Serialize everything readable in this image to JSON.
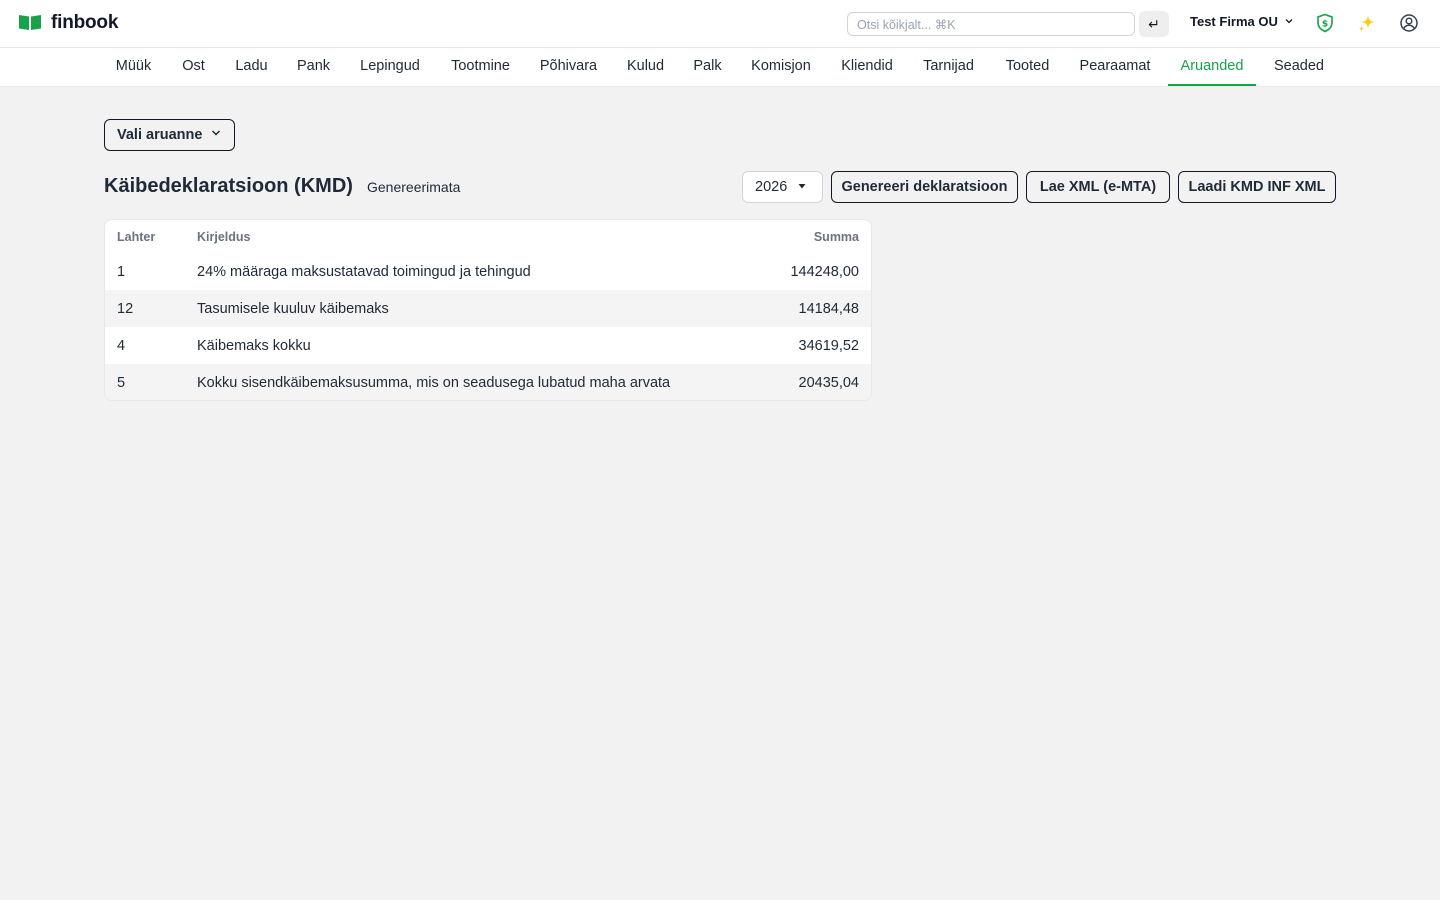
{
  "app": {
    "name": "finbook"
  },
  "search": {
    "placeholder": "Otsi kõikjalt...  ⌘K"
  },
  "header": {
    "enter_icon": "↵",
    "company": "Test Firma OU"
  },
  "nav": {
    "tabs": [
      {
        "label": "Müük"
      },
      {
        "label": "Ost"
      },
      {
        "label": "Ladu"
      },
      {
        "label": "Pank"
      },
      {
        "label": "Lepingud"
      },
      {
        "label": "Tootmine"
      },
      {
        "label": "Põhivara"
      },
      {
        "label": "Kulud"
      },
      {
        "label": "Palk"
      },
      {
        "label": "Komisjon"
      },
      {
        "label": "Kliendid"
      },
      {
        "label": "Tarnijad"
      },
      {
        "label": "Tooted"
      },
      {
        "label": "Pearaamat"
      },
      {
        "label": "Aruanded"
      },
      {
        "label": "Seaded"
      }
    ],
    "active": "Aruanded"
  },
  "report_select": {
    "label": "Vali aruanne"
  },
  "page": {
    "title": "Käibedeklaratsioon (KMD)",
    "status": "Genereerimata"
  },
  "year_select": {
    "value": "2026"
  },
  "actions": {
    "generate": "Genereeri deklaratsioon",
    "upload_xml": "Lae XML (e-MTA)",
    "download_inf": "Laadi KMD INF XML"
  },
  "table": {
    "headers": {
      "box": "Lahter",
      "description": "Kirjeldus",
      "sum": "Summa"
    },
    "rows": [
      {
        "box": "1",
        "description": "24% määraga maksustatavad toimingud ja tehingud",
        "sum": "144248,00"
      },
      {
        "box": "12",
        "description": "Tasumisele kuuluv käibemaks",
        "sum": "14184,48"
      },
      {
        "box": "4",
        "description": "Käibemaks kokku",
        "sum": "34619,52"
      },
      {
        "box": "5",
        "description": "Kokku sisendkäibemaksusumma, mis on seadusega lubatud maha arvata",
        "sum": "20435,04"
      }
    ]
  },
  "colors": {
    "accent": "#16a34a",
    "background": "#f2f2f2",
    "sparkle": "#facc15"
  },
  "icons": {
    "logo": "book-icon",
    "shield": "shield-dollar-icon",
    "sparkle": "sparkle-icon",
    "user": "user-circle-icon",
    "chevron": "chevron-down-icon",
    "caret": "caret-down-icon"
  }
}
